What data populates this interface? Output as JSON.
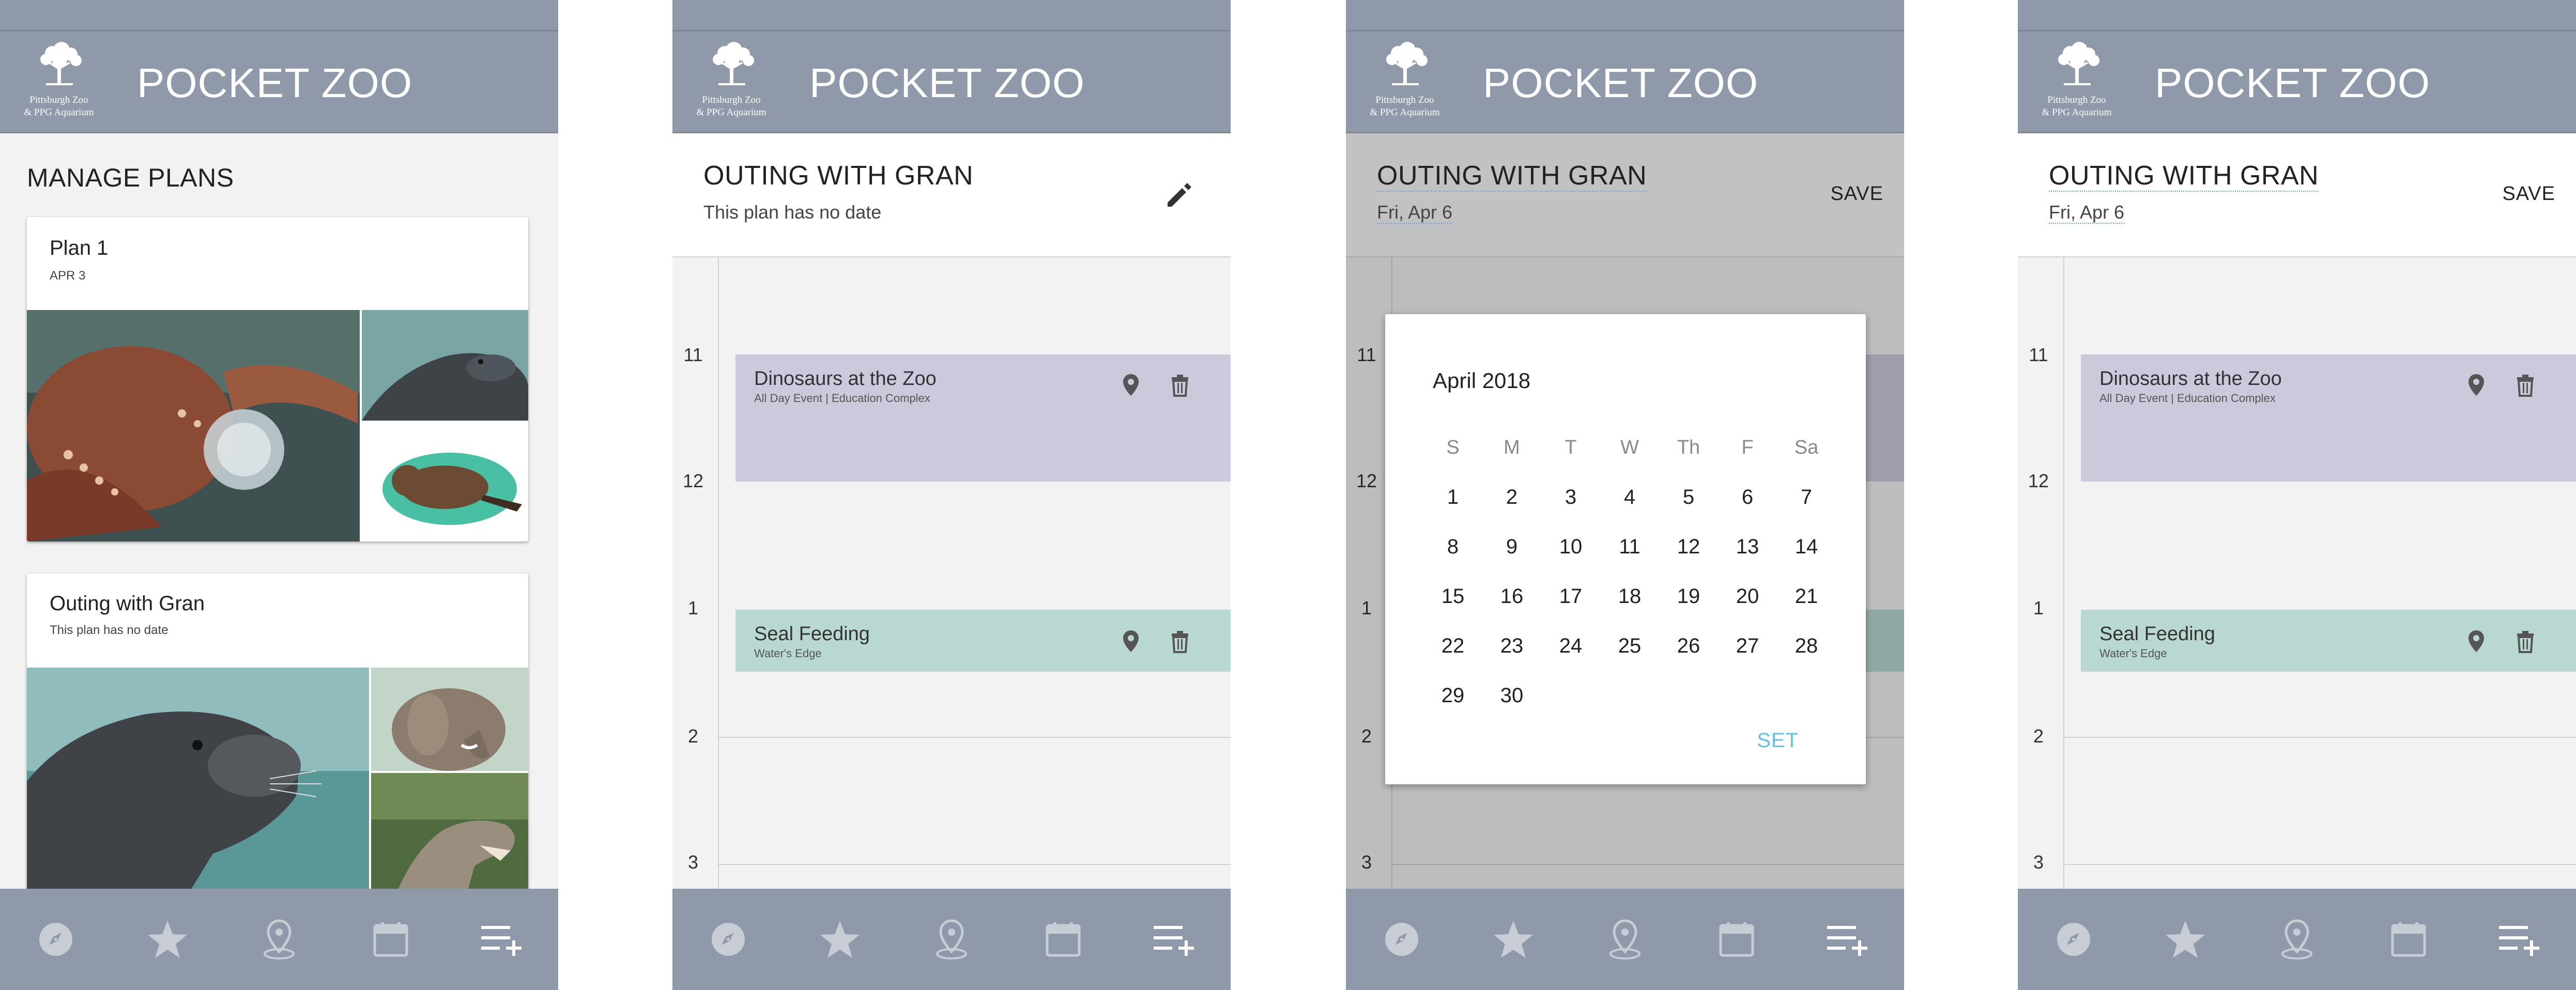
{
  "app": {
    "title": "POCKET ZOO",
    "logo_line1": "Pittsburgh Zoo",
    "logo_line2": "& PPG Aquarium"
  },
  "colors": {
    "header": "#8f99aa",
    "event_lavender": "#cbc9db",
    "event_teal": "#b9d8d1",
    "accent_set": "#5ec2e6"
  },
  "nav": [
    {
      "icon": "compass-icon"
    },
    {
      "icon": "star-icon"
    },
    {
      "icon": "map-pin-icon"
    },
    {
      "icon": "calendar-icon"
    },
    {
      "icon": "add-to-list-icon"
    }
  ],
  "screen1": {
    "section_title": "MANAGE PLANS",
    "plans": [
      {
        "name": "Plan 1",
        "date": "APR 3",
        "photos": [
          "octopus",
          "sea-lion",
          "beaver"
        ]
      },
      {
        "name": "Outing with Gran",
        "date": "This plan has no date",
        "photos": [
          "sea-lion",
          "elephant",
          "dinosaur"
        ]
      }
    ]
  },
  "plan": {
    "title": "OUTING WITH GRAN",
    "no_date": "This plan has no date",
    "date": "Fri, Apr 6",
    "save_label": "SAVE"
  },
  "timeline": {
    "hours": [
      "11",
      "12",
      "1",
      "2",
      "3"
    ],
    "events": [
      {
        "title": "Dinosaurs at the Zoo",
        "subtitle": "All Day Event | Education Complex",
        "color": "lavender"
      },
      {
        "title": "Seal Feeding",
        "subtitle": "Water's Edge",
        "color": "teal"
      }
    ]
  },
  "date_picker": {
    "month": "April 2018",
    "weekdays": [
      "S",
      "M",
      "T",
      "W",
      "Th",
      "F",
      "Sa"
    ],
    "days": [
      "1",
      "2",
      "3",
      "4",
      "5",
      "6",
      "7",
      "8",
      "9",
      "10",
      "11",
      "12",
      "13",
      "14",
      "15",
      "16",
      "17",
      "18",
      "19",
      "20",
      "21",
      "22",
      "23",
      "24",
      "25",
      "26",
      "27",
      "28",
      "29",
      "30"
    ],
    "set_label": "SET"
  }
}
